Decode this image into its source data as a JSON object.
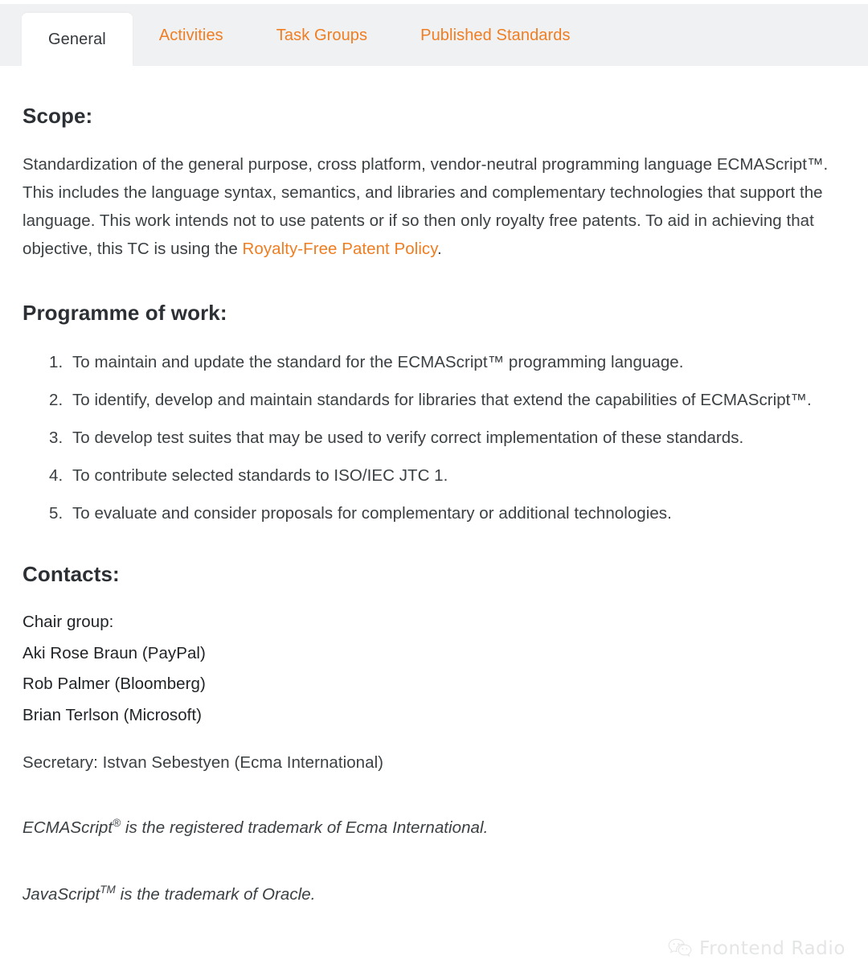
{
  "tabs": [
    {
      "label": "General",
      "active": true
    },
    {
      "label": "Activities",
      "active": false
    },
    {
      "label": "Task Groups",
      "active": false
    },
    {
      "label": "Published Standards",
      "active": false
    }
  ],
  "scope": {
    "heading": "Scope:",
    "paragraph_before_link": "Standardization of the general purpose, cross platform, vendor-neutral programming language ECMAScript™. This includes the language syntax, semantics, and libraries and complementary technologies that support the language. This work intends not to use patents or if so then only royalty free patents. To aid in achieving that objective, this TC is using the ",
    "link_text": "Royalty-Free Patent Policy",
    "paragraph_after_link": "."
  },
  "programme": {
    "heading": "Programme of work:",
    "items": [
      "To maintain and update the standard for the ECMAScript™ programming language.",
      "To identify, develop and maintain standards for libraries that extend the capabilities of ECMAScript™.",
      "To develop test suites that may be used to verify correct implementation of these standards.",
      "To contribute selected standards to ISO/IEC JTC 1.",
      "To evaluate and consider proposals for complementary or additional technologies."
    ]
  },
  "contacts": {
    "heading": "Contacts:",
    "chair_group_label": "Chair group:",
    "chairs": [
      "Aki Rose Braun (PayPal)",
      "Rob Palmer (Bloomberg)",
      "Brian Terlson (Microsoft)"
    ],
    "secretary": "Secretary: Istvan Sebestyen (Ecma International)"
  },
  "trademarks": [
    {
      "name": "ECMAScript",
      "mark": "®",
      "rest": " is the registered trademark of Ecma International."
    },
    {
      "name": "JavaScript",
      "mark": "TM",
      "rest": " is the trademark of Oracle."
    }
  ],
  "watermark": {
    "label": "Frontend Radio",
    "icon": "wechat-icon"
  },
  "colors": {
    "accent": "#ef7e22",
    "tabbar_background": "#f0f1f3",
    "active_tab_text": "#35393d",
    "body_text": "#3b4043"
  }
}
